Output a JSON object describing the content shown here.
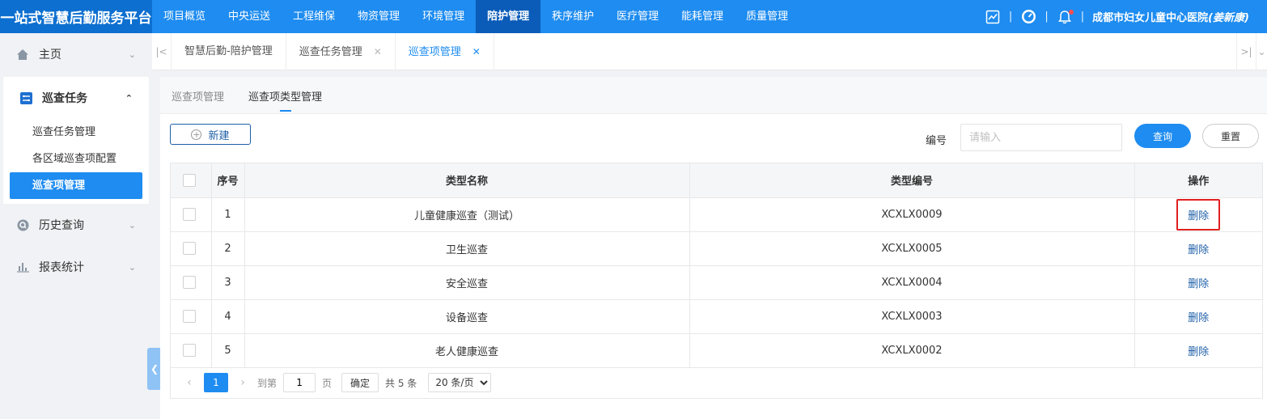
{
  "header": {
    "brand": "一站式智慧后勤服务平台",
    "nav": [
      "项目概览",
      "中央运送",
      "工程维保",
      "物资管理",
      "环境管理",
      "陪护管理",
      "秩序维护",
      "医疗管理",
      "能耗管理",
      "质量管理"
    ],
    "active_nav": "陪护管理",
    "separator": "|",
    "hospital": "成都市妇女儿童中心医院",
    "user": "(姜新康)"
  },
  "sidebar": {
    "home": "主页",
    "inspection_group": "巡查任务",
    "sub_items": [
      "巡查任务管理",
      "各区域巡查项配置",
      "巡查项管理"
    ],
    "active_sub": "巡查项管理",
    "history": "历史查询",
    "reports": "报表统计"
  },
  "tabs": [
    {
      "label": "智慧后勤-陪护管理",
      "closable": false
    },
    {
      "label": "巡查任务管理",
      "closable": true
    },
    {
      "label": "巡查项管理",
      "closable": true
    }
  ],
  "subtabs": [
    "巡查项管理",
    "巡查项类型管理"
  ],
  "active_subtab": "巡查项类型管理",
  "toolbar": {
    "new_label": "新建",
    "code_label": "编号",
    "code_placeholder": "请输入",
    "query_label": "查询",
    "reset_label": "重置"
  },
  "table": {
    "columns": [
      "序号",
      "类型名称",
      "类型编号",
      "操作"
    ],
    "rows": [
      {
        "index": "1",
        "name": "儿童健康巡查（测试）",
        "code": "XCXLX0009",
        "action": "删除"
      },
      {
        "index": "2",
        "name": "卫生巡查",
        "code": "XCXLX0005",
        "action": "删除"
      },
      {
        "index": "3",
        "name": "安全巡查",
        "code": "XCXLX0004",
        "action": "删除"
      },
      {
        "index": "4",
        "name": "设备巡查",
        "code": "XCXLX0003",
        "action": "删除"
      },
      {
        "index": "5",
        "name": "老人健康巡查",
        "code": "XCXLX0002",
        "action": "删除"
      }
    ]
  },
  "pagination": {
    "current": "1",
    "goto_label": "到第",
    "goto_value": "1",
    "page_unit": "页",
    "confirm_label": "确定",
    "total": "共 5 条",
    "page_size": "20 条/页"
  },
  "colors": {
    "primary": "#1e8cf0",
    "header": "#1e8cf0",
    "highlight": "#e02020"
  }
}
